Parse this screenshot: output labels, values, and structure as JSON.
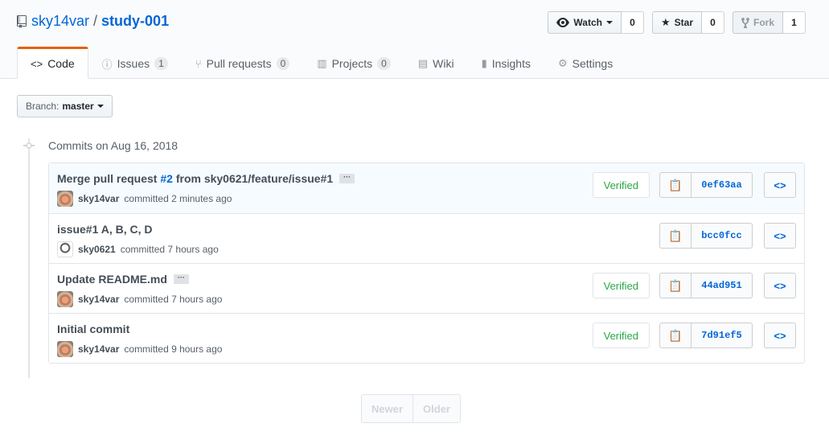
{
  "repo": {
    "owner": "sky14var",
    "separator": "/",
    "name": "study-001"
  },
  "actions": {
    "watch": {
      "label": "Watch",
      "count": "0"
    },
    "star": {
      "label": "Star",
      "count": "0"
    },
    "fork": {
      "label": "Fork",
      "count": "1"
    }
  },
  "tabs": [
    {
      "label": "Code",
      "icon": "code-icon",
      "counter": null
    },
    {
      "label": "Issues",
      "icon": "issue-icon",
      "counter": "1"
    },
    {
      "label": "Pull requests",
      "icon": "pull-request-icon",
      "counter": "0"
    },
    {
      "label": "Projects",
      "icon": "project-icon",
      "counter": "0"
    },
    {
      "label": "Wiki",
      "icon": "book-icon",
      "counter": null
    },
    {
      "label": "Insights",
      "icon": "graph-icon",
      "counter": null
    },
    {
      "label": "Settings",
      "icon": "gear-icon",
      "counter": null
    }
  ],
  "branch": {
    "label": "Branch:",
    "value": "master"
  },
  "group_title": "Commits on Aug 16, 2018",
  "commits": [
    {
      "title_prefix": "Merge pull request ",
      "issue": "#2",
      "title_suffix": " from sky0621/feature/issue#1",
      "ellipsis": true,
      "author": "sky14var",
      "time": "committed 2 minutes ago",
      "verified": "Verified",
      "sha": "0ef63aa"
    },
    {
      "title_prefix": "issue#1 A, B, C, D",
      "issue": "",
      "title_suffix": "",
      "ellipsis": false,
      "author": "sky0621",
      "time": "committed 7 hours ago",
      "verified": "",
      "sha": "bcc0fcc"
    },
    {
      "title_prefix": "Update README.md",
      "issue": "",
      "title_suffix": "",
      "ellipsis": true,
      "author": "sky14var",
      "time": "committed 7 hours ago",
      "verified": "Verified",
      "sha": "44ad951"
    },
    {
      "title_prefix": "Initial commit",
      "issue": "",
      "title_suffix": "",
      "ellipsis": false,
      "author": "sky14var",
      "time": "committed 9 hours ago",
      "verified": "Verified",
      "sha": "7d91ef5"
    }
  ],
  "pagination": {
    "newer": "Newer",
    "older": "Older"
  },
  "colors": {
    "link": "#0366d6",
    "verified": "#28a745",
    "tab_accent": "#e36209"
  }
}
